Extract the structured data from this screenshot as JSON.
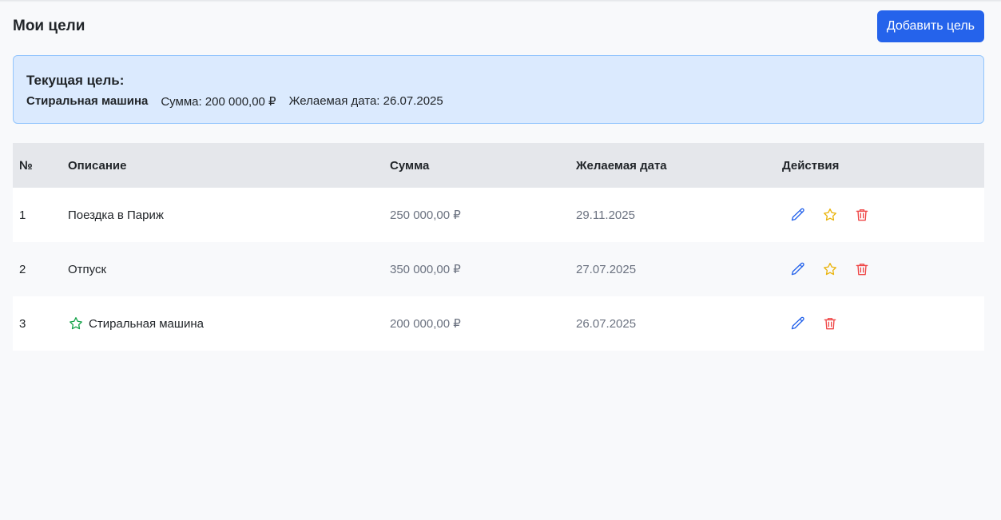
{
  "header": {
    "title": "Мои цели",
    "add_button": "Добавить цель"
  },
  "current_goal": {
    "title": "Текущая цель:",
    "name": "Стиральная машина",
    "amount": "Сумма: 200 000,00 ₽",
    "date": "Желаемая дата: 26.07.2025"
  },
  "table": {
    "headers": [
      "№",
      "Описание",
      "Сумма",
      "Желаемая дата",
      "Действия"
    ],
    "rows": [
      {
        "num": "1",
        "description": "Поездка в Париж",
        "amount": "250 000,00 ₽",
        "date": "29.11.2025",
        "is_current": false
      },
      {
        "num": "2",
        "description": "Отпуск",
        "amount": "350 000,00 ₽",
        "date": "27.07.2025",
        "is_current": false
      },
      {
        "num": "3",
        "description": "Стиральная машина",
        "amount": "200 000,00 ₽",
        "date": "26.07.2025",
        "is_current": true
      }
    ]
  },
  "colors": {
    "primary": "#2563eb",
    "edit_icon": "#2563eb",
    "star_icon": "#eab308",
    "current_star_icon": "#16a34a",
    "delete_icon": "#ef4444",
    "current_bg": "#dbeafe"
  },
  "icons": {
    "edit": "pencil-icon",
    "set_current": "star-icon",
    "delete": "trash-icon",
    "current_marker": "star-outline-icon"
  }
}
